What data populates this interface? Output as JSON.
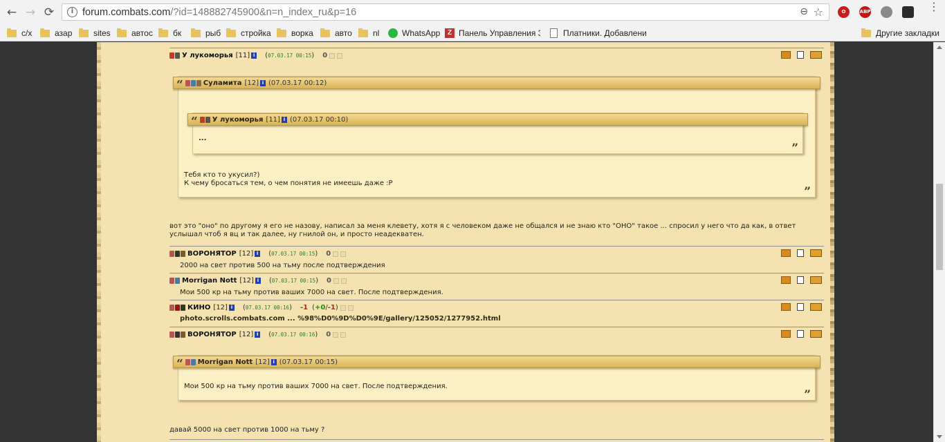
{
  "browser": {
    "url_host": "forum.combats.com",
    "url_path": "/?id=148882745900&n=n_index_ru&p=16",
    "extension_abp": "ABP",
    "bookmarks": [
      "с/х",
      "азар",
      "sites",
      "автос",
      "бк",
      "рыб",
      "стройка",
      "ворка",
      "авто",
      "nl",
      "WhatsApp",
      "Панель Управления За",
      "Платники. Добавление"
    ],
    "other_bookmarks": "Другие закладки",
    "z_icon": "Z"
  },
  "posts": [
    {
      "nick": "У лукоморья",
      "level": "[11]",
      "info": "i",
      "date": "07.03.17 00:15",
      "open": "(",
      "close": ")",
      "rating": "0"
    },
    {
      "nick": "ВОРОНЯТОР",
      "level": "[12]",
      "info": "i",
      "date": "07.03.17 00:15",
      "open": "(",
      "close": ")",
      "rating": "0",
      "body": "2000 на свет против 500 на тьму после подтверждения"
    },
    {
      "nick": "Morrigan Nott",
      "level": "[12]",
      "info": "i",
      "date": "07.03.17 00:15",
      "open": "(",
      "close": ")",
      "rating": "0",
      "body": "Мои 500 кр на тьму против ваших 7000 на свет. После подтверждения."
    },
    {
      "nick": "КИНО",
      "level": "[12]",
      "info": "i",
      "date": "07.03.17 00:16",
      "open": "(",
      "close": ")",
      "rating": "-1",
      "rating_open": "(",
      "rating_plus": "+0",
      "rating_slash": "/",
      "rating_minus": "-1",
      "rating_close": ")",
      "body": "photo.scrolls.combats.com ... %98%D0%9D%D0%9E/gallery/125052/1277952.html"
    },
    {
      "nick": "ВОРОНЯТОР",
      "level": "[12]",
      "info": "i",
      "date": "07.03.17 00:16",
      "open": "(",
      "close": ")",
      "rating": "0"
    }
  ],
  "quotes": {
    "q1": {
      "mark": "“",
      "end": "”",
      "nick": "Суламита",
      "level": "[12]",
      "info": "i",
      "date": "(07.03.17 00:12)",
      "lines": [
        "Тебя кто то укусил?)",
        "К чему бросаться тем, о чем понятия не имеешь даже :P"
      ]
    },
    "q1_inner": {
      "mark": "“",
      "end": "”",
      "nick": "У лукоморья",
      "level": "[11]",
      "info": "i",
      "date": "(07.03.17 00:10)",
      "text": "..."
    },
    "q2": {
      "mark": "“",
      "end": "”",
      "nick": "Morrigan Nott",
      "level": "[12]",
      "info": "i",
      "date": "(07.03.17 00:15)",
      "text": "Мои 500 кр на тьму против ваших 7000 на свет. После подтверждения."
    }
  },
  "post1_reply": "вот это \"оно\" по другому я его не назову, написал за меня клевету, хотя я с человеком даже не общался и не знаю кто \"ОНО\" такое ... спросил у него что да как, в ответ услышал чтоб я вц и так далее, ну гнилой он, и просто неадекватен.",
  "post5_reply": "давай 5000 на свет против 1000 на тьму ?",
  "colors": {
    "parchment": "#f4e3b0",
    "quote_bar": "#d8b458",
    "date_green": "#2a7a2a",
    "negative": "#c02020",
    "positive": "#1a8a1a"
  }
}
